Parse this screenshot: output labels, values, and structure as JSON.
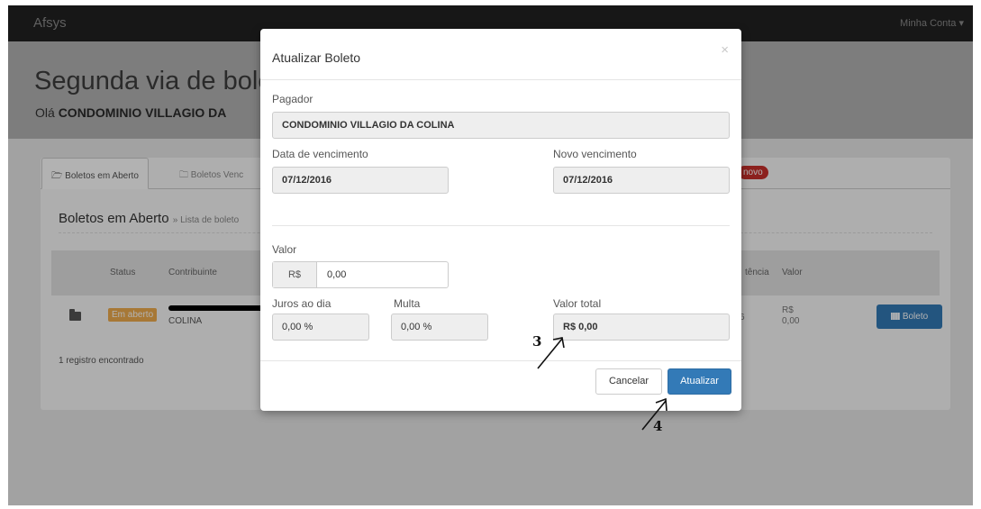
{
  "navbar": {
    "brand": "Afsys",
    "account_label": "Minha Conta ▾"
  },
  "header": {
    "title": "Segunda via de bole",
    "greeting_prefix": "Olá ",
    "greeting_name": "CONDOMINIO VILLAGIO DA"
  },
  "tabs": [
    {
      "label": "🗁 Boletos em Aberto",
      "active": true
    },
    {
      "label": "🗀 Boletos Venc",
      "active": false
    }
  ],
  "novo_badge": "novo",
  "section": {
    "title": "Boletos em Aberto",
    "subtitle": "» Lista de boleto"
  },
  "table": {
    "headers": {
      "status": "Status",
      "contribuinte": "Contribuinte",
      "vencimento": "tência",
      "valor": "Valor"
    },
    "row": {
      "status_label": "Em aberto",
      "contribuinte": "COLINA",
      "vencimento_partial": "6",
      "valor_currency": "R$",
      "valor_amount": "0,00",
      "boleto_button": "Boleto"
    }
  },
  "records_text": "1 registro encontrado",
  "modal": {
    "title": "Atualizar Boleto",
    "close_glyph": "×",
    "pagador_label": "Pagador",
    "pagador_value": "CONDOMINIO VILLAGIO DA COLINA",
    "data_vencimento_label": "Data de vencimento",
    "data_vencimento_value": "07/12/2016",
    "novo_vencimento_label": "Novo vencimento",
    "novo_vencimento_value": "07/12/2016",
    "valor_label": "Valor",
    "valor_addon": "R$",
    "valor_value": "0,00",
    "juros_label": "Juros ao dia",
    "juros_value": "0,00 %",
    "multa_label": "Multa",
    "multa_value": "0,00 %",
    "valor_total_label": "Valor total",
    "valor_total_value": "R$ 0,00",
    "cancel_button": "Cancelar",
    "update_button": "Atualizar"
  },
  "annotations": {
    "step3": "3",
    "step4": "4"
  },
  "colors": {
    "primary": "#337ab7",
    "warning": "#f0ad4e",
    "danger": "#c9302c",
    "navbar": "#222222"
  }
}
